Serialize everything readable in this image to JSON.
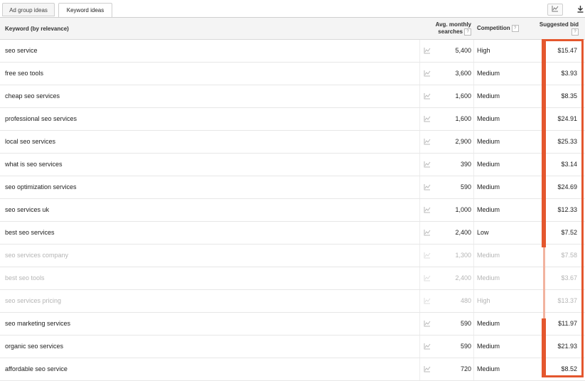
{
  "tabs": [
    {
      "label": "Ad group ideas",
      "active": false
    },
    {
      "label": "Keyword ideas",
      "active": true
    }
  ],
  "toolbar": {
    "chart_icon": "line-chart-icon",
    "download_icon": "download-icon"
  },
  "table": {
    "headers": {
      "keyword": "Keyword (by relevance)",
      "avg_line1": "Avg. monthly",
      "avg_line2": "searches",
      "competition": "Competition",
      "bid_line1": "Suggested bid",
      "help": "?"
    },
    "rows": [
      {
        "keyword": "seo service",
        "avg": "5,400",
        "competition": "High",
        "bid": "$15.47",
        "dimmed": false
      },
      {
        "keyword": "free seo tools",
        "avg": "3,600",
        "competition": "Medium",
        "bid": "$3.93",
        "dimmed": false
      },
      {
        "keyword": "cheap seo services",
        "avg": "1,600",
        "competition": "Medium",
        "bid": "$8.35",
        "dimmed": false
      },
      {
        "keyword": "professional seo services",
        "avg": "1,600",
        "competition": "Medium",
        "bid": "$24.91",
        "dimmed": false
      },
      {
        "keyword": "local seo services",
        "avg": "2,900",
        "competition": "Medium",
        "bid": "$25.33",
        "dimmed": false
      },
      {
        "keyword": "what is seo services",
        "avg": "390",
        "competition": "Medium",
        "bid": "$3.14",
        "dimmed": false
      },
      {
        "keyword": "seo optimization services",
        "avg": "590",
        "competition": "Medium",
        "bid": "$24.69",
        "dimmed": false
      },
      {
        "keyword": "seo services uk",
        "avg": "1,000",
        "competition": "Medium",
        "bid": "$12.33",
        "dimmed": false
      },
      {
        "keyword": "best seo services",
        "avg": "2,400",
        "competition": "Low",
        "bid": "$7.52",
        "dimmed": false
      },
      {
        "keyword": "seo services company",
        "avg": "1,300",
        "competition": "Medium",
        "bid": "$7.58",
        "dimmed": true
      },
      {
        "keyword": "best seo tools",
        "avg": "2,400",
        "competition": "Medium",
        "bid": "$3.67",
        "dimmed": true
      },
      {
        "keyword": "seo services pricing",
        "avg": "480",
        "competition": "High",
        "bid": "$13.37",
        "dimmed": true
      },
      {
        "keyword": "seo marketing services",
        "avg": "590",
        "competition": "Medium",
        "bid": "$11.97",
        "dimmed": false
      },
      {
        "keyword": "organic seo services",
        "avg": "590",
        "competition": "Medium",
        "bid": "$21.93",
        "dimmed": false
      },
      {
        "keyword": "affordable seo service",
        "avg": "720",
        "competition": "Medium",
        "bid": "$8.52",
        "dimmed": false
      }
    ]
  },
  "highlight": {
    "color": "#e4572e"
  }
}
